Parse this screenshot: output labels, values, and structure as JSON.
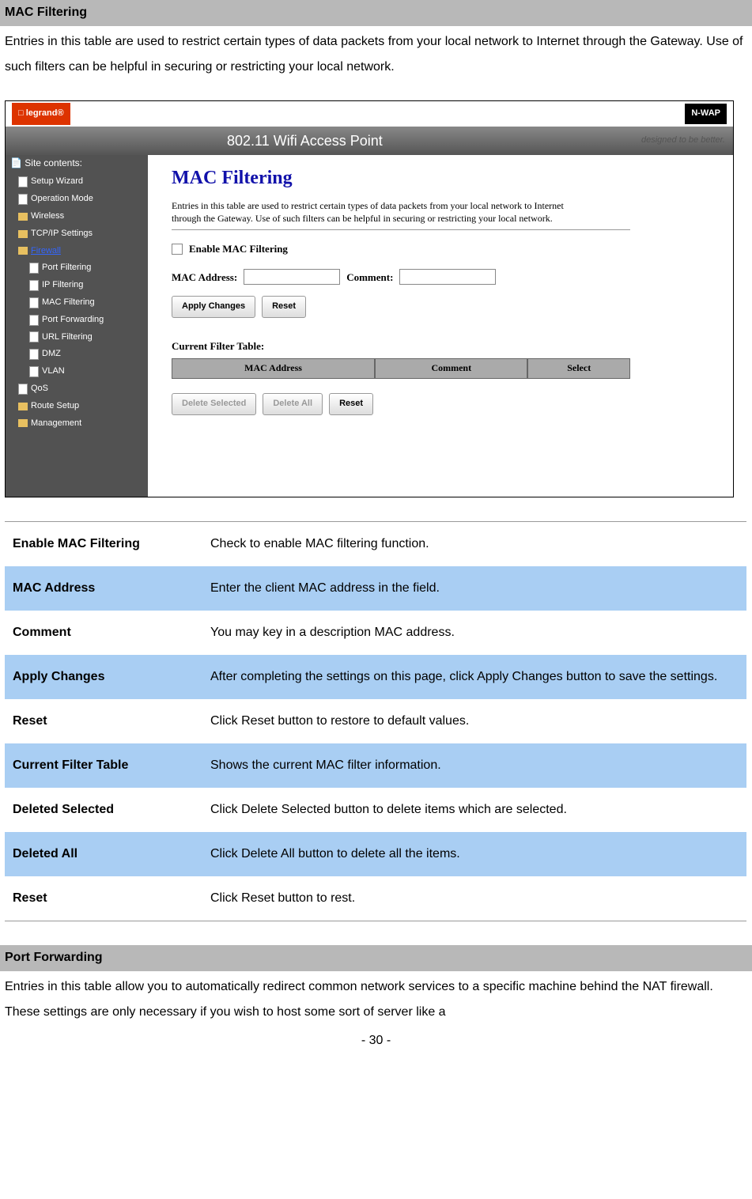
{
  "section1": {
    "header": "MAC Filtering",
    "intro": "Entries in this table are used to restrict certain types of data packets from your local network to Internet through the Gateway. Use of such filters can be helpful in securing or restricting your local network."
  },
  "screenshot": {
    "logo": "legrand",
    "nwap": "N-WAP",
    "banner": "802.11 Wifi Access Point",
    "tagline": "designed to be better.",
    "sidebar_title": "Site contents:",
    "tree": {
      "setup_wizard": "Setup Wizard",
      "operation_mode": "Operation Mode",
      "wireless": "Wireless",
      "tcpip": "TCP/IP Settings",
      "firewall": "Firewall",
      "port_filtering": "Port Filtering",
      "ip_filtering": "IP Filtering",
      "mac_filtering": "MAC Filtering",
      "port_forwarding": "Port Forwarding",
      "url_filtering": "URL Filtering",
      "dmz": "DMZ",
      "vlan": "VLAN",
      "qos": "QoS",
      "route_setup": "Route Setup",
      "management": "Management"
    },
    "main": {
      "title": "MAC Filtering",
      "desc": "Entries in this table are used to restrict certain types of data packets from your local network to Internet through the Gateway. Use of such filters can be helpful in securing or restricting your local network.",
      "enable_label": "Enable MAC Filtering",
      "mac_label": "MAC Address:",
      "comment_label": "Comment:",
      "apply_btn": "Apply Changes",
      "reset_btn": "Reset",
      "table_title": "Current Filter Table:",
      "th_mac": "MAC Address",
      "th_comment": "Comment",
      "th_select": "Select",
      "del_sel": "Delete Selected",
      "del_all": "Delete All",
      "reset2": "Reset"
    }
  },
  "params": [
    {
      "label": "Enable MAC Filtering",
      "desc": "Check to enable MAC filtering function."
    },
    {
      "label": "MAC Address",
      "desc": "Enter the client MAC address in the field."
    },
    {
      "label": "Comment",
      "desc": "You may key in a description MAC address."
    },
    {
      "label": "Apply Changes",
      "desc": "After completing the settings on this page, click Apply Changes button to save the settings."
    },
    {
      "label": "Reset",
      "desc": "Click Reset button to restore to default values."
    },
    {
      "label": "Current Filter Table",
      "desc": "Shows the current MAC filter information."
    },
    {
      "label": "Deleted Selected",
      "desc": "Click Delete Selected button to delete items which are selected."
    },
    {
      "label": "Deleted All",
      "desc": "Click Delete All button to delete all the items."
    },
    {
      "label": "Reset",
      "desc": "Click Reset button to rest."
    }
  ],
  "section2": {
    "header": "Port Forwarding",
    "intro": "Entries in this table allow you to automatically redirect common network services to a specific machine behind the NAT firewall. These settings are only necessary if you wish to host some sort of server like a"
  },
  "page_num": "- 30 -"
}
